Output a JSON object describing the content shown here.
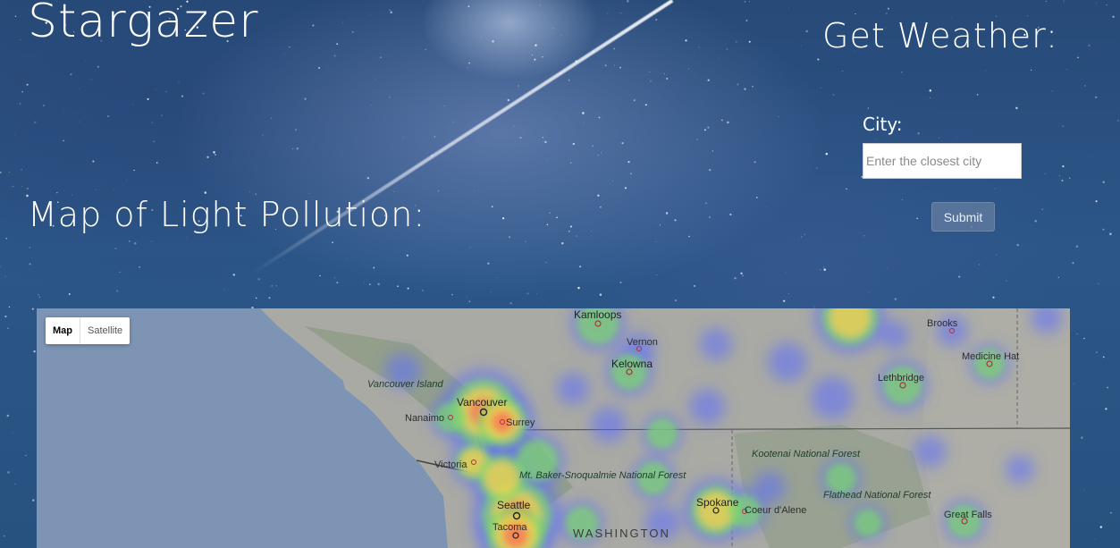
{
  "header": {
    "title": "Stargazer"
  },
  "weather": {
    "heading": "Get Weather:",
    "city_label": "City:",
    "city_value": "",
    "city_placeholder": "Enter the closest city",
    "submit_label": "Submit"
  },
  "map_section": {
    "heading": "Map of Light Pollution:",
    "map_type": {
      "map_label": "Map",
      "satellite_label": "Satellite",
      "selected": "Map"
    },
    "cities": [
      "Kamloops",
      "Vernon",
      "Kelowna",
      "Vancouver",
      "Surrey",
      "Nanaimo",
      "Victoria",
      "Seattle",
      "Tacoma",
      "Spokane",
      "Coeur d'Alene",
      "Lethbridge",
      "Medicine Hat",
      "Brooks",
      "Great Falls"
    ],
    "regions": {
      "vancouver_island": "Vancouver Island",
      "mt_baker": "Mt. Baker-Snoqualmie National Forest",
      "kootenai": "Kootenai National Forest",
      "flathead": "Flathead National Forest",
      "washington": "WASHINGTON"
    },
    "colors": {
      "water": "#7d94b4",
      "land": "#a9aaa4",
      "forest": "#8a9a80",
      "low": "#5b6cff",
      "mid": "#7fd86a",
      "high": "#ffd24a",
      "peak": "#ff6a5a"
    }
  }
}
